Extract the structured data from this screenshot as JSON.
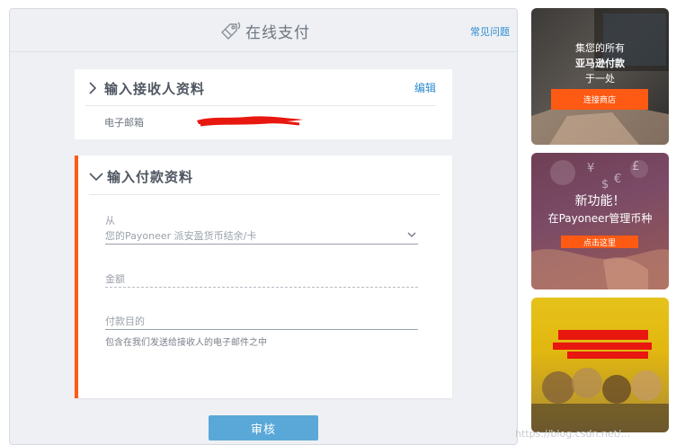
{
  "header": {
    "title": "在线支付",
    "faq_link": "常见问题"
  },
  "recipient": {
    "title": "输入接收人资料",
    "edit_label": "编辑",
    "email_label": "电子邮箱"
  },
  "payment": {
    "title": "输入付款资料",
    "from_label": "从",
    "from_value": "您的Payoneer 派安盈货币结余/卡",
    "amount_placeholder": "金额",
    "purpose_placeholder": "付款目的",
    "purpose_hint": "包含在我们发送给接收人的电子邮件之中"
  },
  "submit_label": "审核",
  "ads": {
    "ad1": {
      "line1": "集您的所有",
      "line2": "亚马逊付款",
      "line3": "于一处",
      "button": "连接商店"
    },
    "ad2": {
      "line1": "新功能！",
      "line2": "在Payoneer管理币种",
      "button": "点击这里"
    }
  },
  "colors": {
    "accent": "#ff5a14",
    "link": "#2d8ccf",
    "submit": "#5aa8d8"
  },
  "watermark": "https://blog.csdn.net/..."
}
